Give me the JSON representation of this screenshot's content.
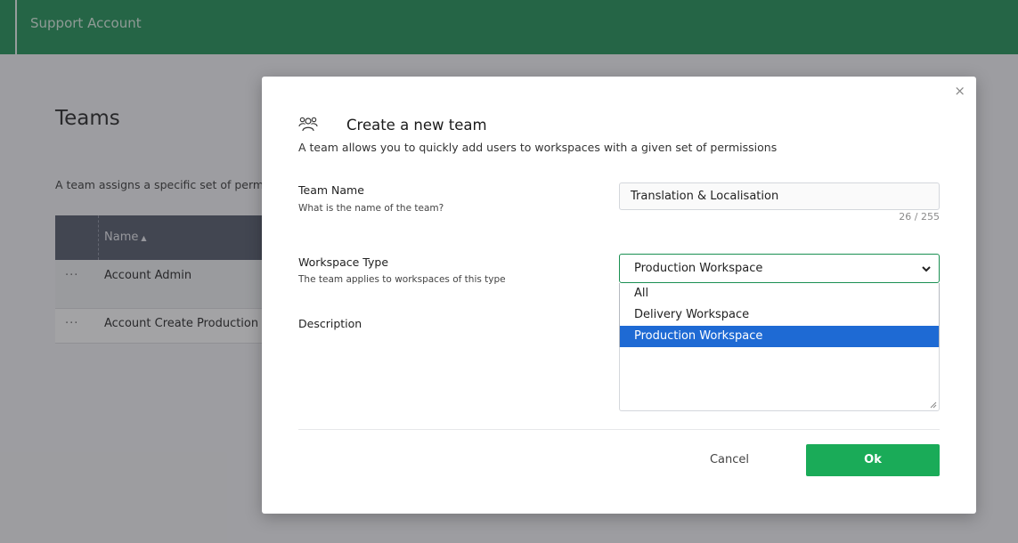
{
  "header": {
    "title": "Support Account"
  },
  "page": {
    "title": "Teams",
    "description": "A team assigns a specific set of permis",
    "table": {
      "name_header": "Name",
      "sort_indicator": "▲",
      "rows": [
        {
          "actions": "···",
          "name": "Account Admin"
        },
        {
          "actions": "···",
          "name": "Account Create Production"
        }
      ]
    }
  },
  "modal": {
    "close_glyph": "×",
    "icon": "team-icon",
    "title": "Create a new team",
    "subtitle": "A team allows you to quickly add users to workspaces with a given set of permissions",
    "team_name": {
      "label": "Team Name",
      "hint": "What is the name of the team?",
      "value": "Translation & Localisation",
      "counter": "26 / 255"
    },
    "workspace_type": {
      "label": "Workspace Type",
      "hint": "The team applies to workspaces of this type",
      "selected": "Production Workspace",
      "options": [
        "All",
        "Delivery Workspace",
        "Production Workspace"
      ]
    },
    "description": {
      "label": "Description"
    },
    "cancel_label": "Cancel",
    "ok_label": "Ok"
  },
  "colors": {
    "header": "#1a8f52",
    "ok_button": "#1aab58",
    "selected_option": "#1e6ad4"
  }
}
